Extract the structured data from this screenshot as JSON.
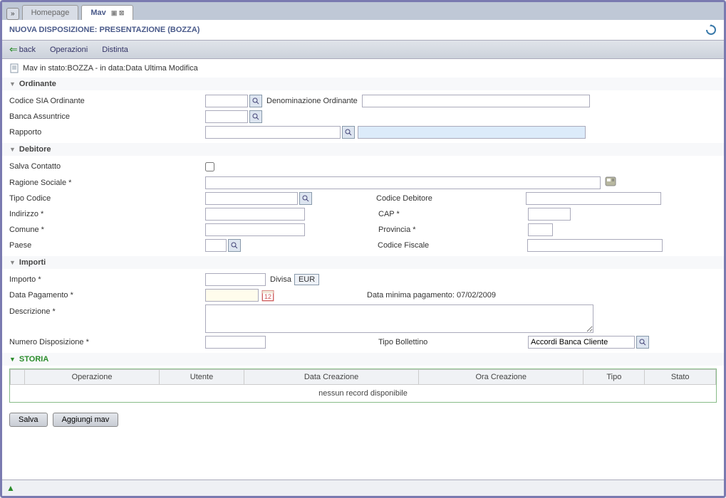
{
  "tabs": {
    "homepage": "Homepage",
    "mav": "Mav"
  },
  "title": "NUOVA DISPOSIZIONE: PRESENTAZIONE (BOZZA)",
  "toolbar": {
    "back": "back",
    "operazioni": "Operazioni",
    "distinta": "Distinta"
  },
  "status_line": "Mav in stato:BOZZA - in data:Data Ultima Modifica",
  "sections": {
    "ordinante": "Ordinante",
    "debitore": "Debitore",
    "importi": "Importi",
    "storia": "STORIA"
  },
  "ordinante": {
    "codice_sia_label": "Codice SIA Ordinante",
    "denominazione_label": "Denominazione Ordinante",
    "banca_label": "Banca Assuntrice",
    "rapporto_label": "Rapporto"
  },
  "debitore": {
    "salva_contatto_label": "Salva Contatto",
    "ragione_sociale_label": "Ragione Sociale *",
    "tipo_codice_label": "Tipo Codice",
    "codice_debitore_label": "Codice Debitore",
    "indirizzo_label": "Indirizzo *",
    "cap_label": "CAP *",
    "comune_label": "Comune *",
    "provincia_label": "Provincia *",
    "paese_label": "Paese",
    "codice_fiscale_label": "Codice Fiscale"
  },
  "importi": {
    "importo_label": "Importo *",
    "divisa_label": "Divisa",
    "divisa_value": "EUR",
    "data_pagamento_label": "Data Pagamento *",
    "data_minima_label": "Data minima pagamento: 07/02/2009",
    "descrizione_label": "Descrizione *",
    "numero_disposizione_label": "Numero Disposizione *",
    "tipo_bollettino_label": "Tipo Bollettino",
    "tipo_bollettino_value": "Accordi Banca Cliente"
  },
  "storia_table": {
    "headers": [
      "Operazione",
      "Utente",
      "Data Creazione",
      "Ora Creazione",
      "Tipo",
      "Stato"
    ],
    "empty_message": "nessun record disponibile"
  },
  "buttons": {
    "salva": "Salva",
    "aggiungi": "Aggiungi mav"
  }
}
